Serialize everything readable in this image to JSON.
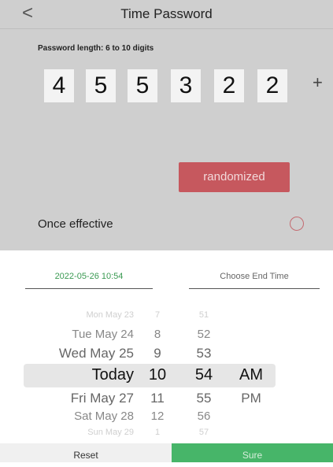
{
  "header": {
    "back_icon": "<",
    "title": "Time Password"
  },
  "password": {
    "length_label": "Password length: 6 to 10 digits",
    "digits": [
      "4",
      "5",
      "5",
      "3",
      "2",
      "2"
    ],
    "add_label": "+",
    "randomize_label": "randomized"
  },
  "once": {
    "label": "Once effective",
    "checked": false
  },
  "time_range": {
    "start": "2022-05-26 10:54",
    "end_placeholder": "Choose End Time"
  },
  "picker": {
    "dates": [
      "Mon May 23",
      "Tue May 24",
      "Wed May 25",
      "Today",
      "Fri May 27",
      "Sat May 28",
      "Sun May 29"
    ],
    "hours": [
      "7",
      "8",
      "9",
      "10",
      "11",
      "12",
      "1"
    ],
    "minutes": [
      "51",
      "52",
      "53",
      "54",
      "55",
      "56",
      "57"
    ],
    "ampm": [
      "AM",
      "PM"
    ],
    "selected_date": "Today",
    "selected_hour": "10",
    "selected_minute": "54",
    "selected_ampm": "AM"
  },
  "footer": {
    "reset_label": "Reset",
    "sure_label": "Sure"
  },
  "colors": {
    "accent_green": "#47b569",
    "randomize_red": "#c6585e"
  }
}
